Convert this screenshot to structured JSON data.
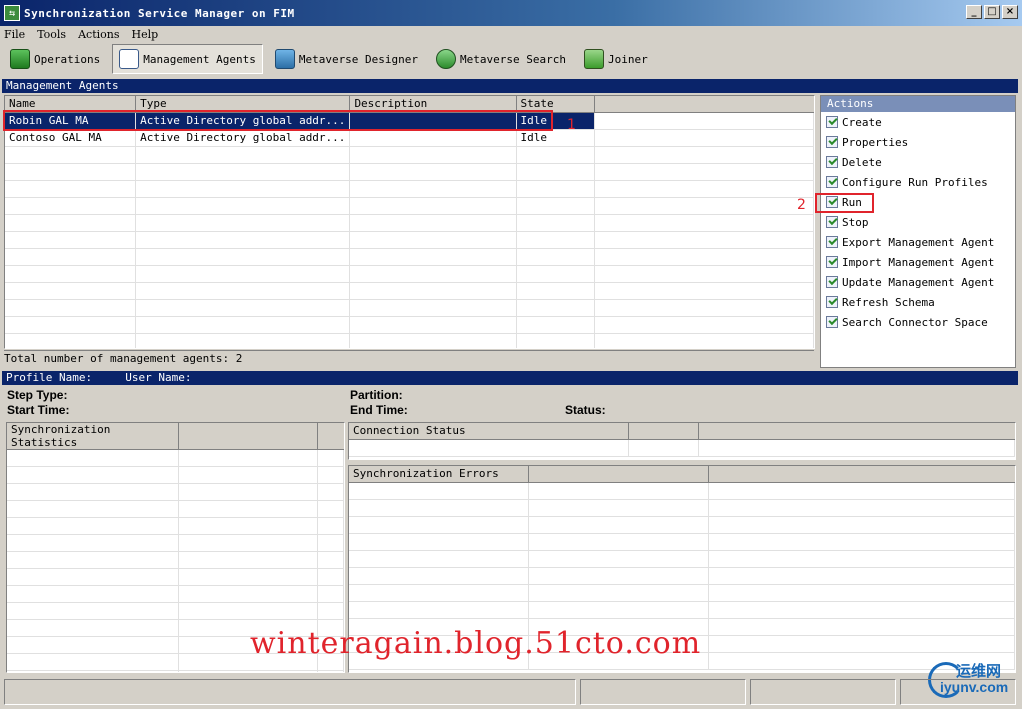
{
  "window": {
    "title": "Synchronization Service Manager on FIM"
  },
  "menu": [
    "File",
    "Tools",
    "Actions",
    "Help"
  ],
  "toolbar": {
    "operations": "Operations",
    "management_agents": "Management Agents",
    "metaverse_designer": "Metaverse Designer",
    "metaverse_search": "Metaverse Search",
    "joiner": "Joiner"
  },
  "ma_section": {
    "title": "Management Agents",
    "columns": [
      "Name",
      "Type",
      "Description",
      "State"
    ],
    "rows": [
      {
        "name": "Robin GAL MA",
        "type": "Active Directory global addr...",
        "description": "",
        "state": "Idle"
      },
      {
        "name": "Contoso GAL MA",
        "type": "Active Directory global addr...",
        "description": "",
        "state": "Idle"
      }
    ],
    "total_label": "Total number of management agents: 2"
  },
  "actions": {
    "title": "Actions",
    "items": [
      "Create",
      "Properties",
      "Delete",
      "Configure Run Profiles",
      "Run",
      "Stop",
      "Export Management Agent",
      "Import Management Agent",
      "Update Management Agent",
      "Refresh Schema",
      "Search Connector Space"
    ]
  },
  "profile_bar": {
    "profile_name": "Profile Name:",
    "user_name": "User Name:"
  },
  "details": {
    "step_type": "Step Type:",
    "start_time": "Start Time:",
    "partition": "Partition:",
    "end_time": "End Time:",
    "status": "Status:"
  },
  "sync_stats": {
    "header": "Synchronization Statistics"
  },
  "connection_status": {
    "header": "Connection Status"
  },
  "sync_errors": {
    "header": "Synchronization Errors"
  },
  "annotations": {
    "one": "1",
    "two": "2"
  },
  "watermark": "winteragain.blog.51cto.com",
  "logo": {
    "line1": "运维网",
    "line2": "iyunv.com"
  }
}
